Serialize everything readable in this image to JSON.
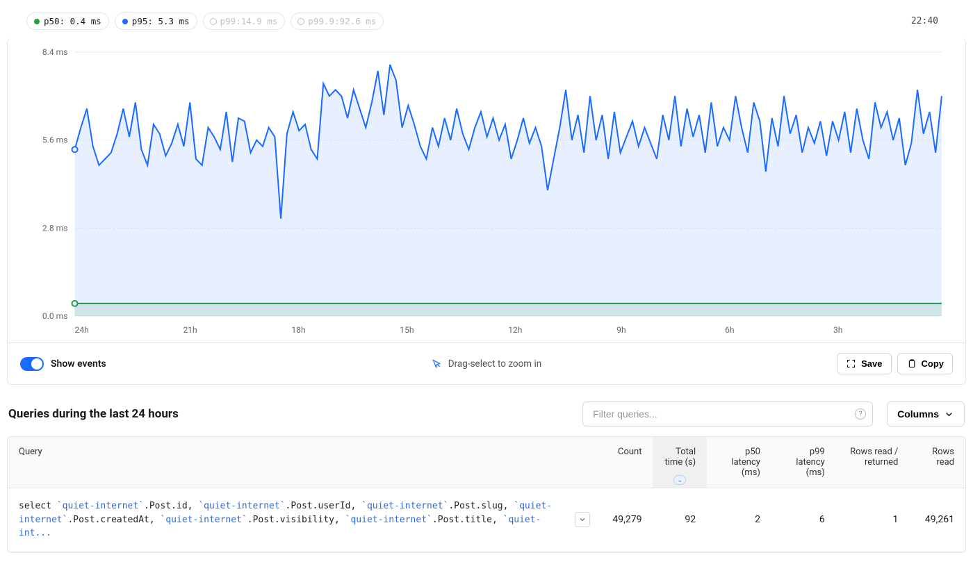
{
  "colors": {
    "p50": "#1f9e3e",
    "p95": "#1a6bff",
    "p99": "#b59cf0",
    "p999": "#f28a5a"
  },
  "legend": {
    "p50_label": "p50: 0.4 ms",
    "p95_label": "p95: 5.3 ms",
    "p99_label": "p99:14.9 ms",
    "p999_label": "p99.9:92.6 ms"
  },
  "time_label": "22:40",
  "chart_data": {
    "type": "line",
    "xlabel": "",
    "ylabel": "",
    "ylim": [
      0.0,
      8.4
    ],
    "y_ticks": [
      "0.0 ms",
      "2.8 ms",
      "5.6 ms",
      "8.4 ms"
    ],
    "x_ticks": [
      "24h",
      "21h",
      "18h",
      "15h",
      "12h",
      "9h",
      "6h",
      "3h"
    ],
    "series": [
      {
        "name": "p50",
        "values": [
          0.4,
          0.4,
          0.4,
          0.4,
          0.4,
          0.4,
          0.4,
          0.4,
          0.4,
          0.4,
          0.4,
          0.4,
          0.4,
          0.4,
          0.4,
          0.4,
          0.4,
          0.4,
          0.4,
          0.4,
          0.4,
          0.4,
          0.4,
          0.4,
          0.4,
          0.4,
          0.4,
          0.4,
          0.4,
          0.4,
          0.4,
          0.4,
          0.4,
          0.4,
          0.4,
          0.4,
          0.4,
          0.4,
          0.4,
          0.4,
          0.4,
          0.4,
          0.4,
          0.4,
          0.4,
          0.4,
          0.4,
          0.4,
          0.4,
          0.4,
          0.4,
          0.4,
          0.4,
          0.4,
          0.4,
          0.4,
          0.4,
          0.4,
          0.4,
          0.4,
          0.4,
          0.4,
          0.4,
          0.4,
          0.4,
          0.4,
          0.4,
          0.4,
          0.4,
          0.4,
          0.4,
          0.4,
          0.4,
          0.4,
          0.4,
          0.4,
          0.4,
          0.4,
          0.4,
          0.4,
          0.4,
          0.4,
          0.4,
          0.4,
          0.4,
          0.4,
          0.4,
          0.4,
          0.4,
          0.4,
          0.4,
          0.4,
          0.4,
          0.4,
          0.4,
          0.4,
          0.4,
          0.4,
          0.4,
          0.4,
          0.4,
          0.4,
          0.4,
          0.4,
          0.4,
          0.4,
          0.4,
          0.4,
          0.4,
          0.4,
          0.4,
          0.4,
          0.4,
          0.4,
          0.4,
          0.4,
          0.4,
          0.4,
          0.4,
          0.4,
          0.4,
          0.4,
          0.4,
          0.4,
          0.4,
          0.4,
          0.4,
          0.4,
          0.4,
          0.4,
          0.4,
          0.4,
          0.4,
          0.4,
          0.4,
          0.4,
          0.4,
          0.4,
          0.4,
          0.4,
          0.4,
          0.4,
          0.4,
          0.4
        ]
      },
      {
        "name": "p95",
        "values": [
          5.3,
          6.0,
          6.6,
          5.4,
          4.8,
          5.0,
          5.2,
          5.8,
          6.6,
          5.7,
          6.8,
          5.3,
          4.8,
          6.1,
          5.8,
          5.1,
          5.5,
          6.1,
          5.4,
          6.8,
          5.0,
          4.8,
          6.0,
          5.7,
          5.3,
          6.5,
          4.9,
          6.3,
          6.2,
          5.2,
          5.6,
          5.4,
          6.0,
          5.7,
          3.1,
          5.8,
          6.5,
          5.9,
          6.1,
          5.3,
          5.0,
          7.4,
          7.0,
          7.2,
          7.0,
          6.3,
          7.2,
          6.6,
          6.0,
          6.8,
          7.8,
          6.4,
          8.0,
          7.5,
          6.0,
          6.7,
          6.1,
          5.4,
          5.0,
          6.0,
          5.4,
          6.3,
          5.6,
          6.6,
          5.8,
          5.3,
          6.0,
          6.5,
          5.7,
          6.3,
          5.6,
          6.1,
          5.0,
          5.6,
          6.3,
          5.5,
          6.0,
          5.4,
          4.0,
          5.0,
          6.0,
          7.2,
          5.6,
          6.4,
          5.2,
          7.0,
          5.6,
          6.4,
          5.0,
          6.5,
          5.2,
          5.7,
          6.2,
          5.4,
          6.0,
          5.5,
          5.0,
          6.4,
          5.6,
          7.0,
          5.4,
          6.6,
          5.7,
          6.4,
          5.2,
          6.8,
          5.4,
          6.0,
          5.6,
          7.0,
          6.0,
          5.2,
          6.8,
          6.2,
          4.6,
          6.3,
          5.4,
          7.0,
          5.8,
          6.4,
          5.2,
          6.0,
          5.5,
          6.2,
          5.1,
          6.2,
          5.6,
          6.5,
          5.2,
          6.6,
          5.6,
          5.0,
          6.8,
          6.0,
          6.5,
          5.6,
          6.3,
          4.8,
          5.5,
          7.2,
          5.8,
          6.5,
          5.2,
          7.0
        ]
      }
    ]
  },
  "footer": {
    "toggle_label": "Show events",
    "hint": "Drag-select to zoom in",
    "save": "Save",
    "copy": "Copy"
  },
  "queries": {
    "title": "Queries during the last 24 hours",
    "filter_placeholder": "Filter queries...",
    "columns_btn": "Columns",
    "headers": {
      "query": "Query",
      "count": "Count",
      "total_time": "Total time (s)",
      "p50": "p50 latency (ms)",
      "p99": "p99 latency (ms)",
      "rows_ratio": "Rows read / returned",
      "rows_read": "Rows read"
    },
    "rows": [
      {
        "sql_parts": [
          {
            "t": "kw",
            "v": "select "
          },
          {
            "t": "db",
            "v": "`quiet-internet`"
          },
          {
            "t": "kw",
            "v": ".Post.id, "
          },
          {
            "t": "db",
            "v": "`quiet-internet`"
          },
          {
            "t": "kw",
            "v": ".Post.userId, "
          },
          {
            "t": "db",
            "v": "`quiet-internet`"
          },
          {
            "t": "kw",
            "v": ".Post.slug, "
          },
          {
            "t": "db",
            "v": "`quiet-internet`"
          },
          {
            "t": "kw",
            "v": ".Post.createdAt, "
          },
          {
            "t": "db",
            "v": "`quiet-internet`"
          },
          {
            "t": "kw",
            "v": ".Post.visibility, "
          },
          {
            "t": "db",
            "v": "`quiet-internet`"
          },
          {
            "t": "kw",
            "v": ".Post.title, "
          },
          {
            "t": "db",
            "v": "`quiet-int..."
          }
        ],
        "count": "49,279",
        "total_time": "92",
        "p50": "2",
        "p99": "6",
        "rows_ratio": "1",
        "rows_read": "49,261"
      }
    ]
  }
}
